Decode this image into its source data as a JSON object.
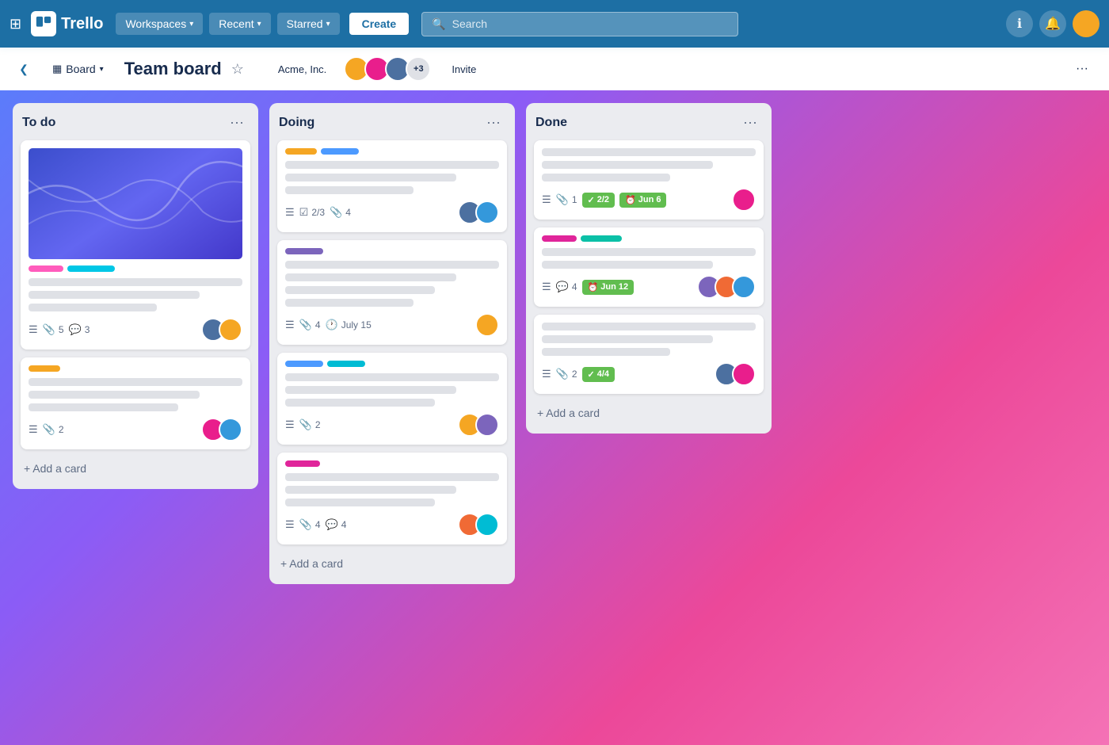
{
  "navbar": {
    "logo_text": "Trello",
    "workspaces_label": "Workspaces",
    "recent_label": "Recent",
    "starred_label": "Starred",
    "create_label": "Create",
    "search_placeholder": "Search",
    "info_label": "info",
    "notification_label": "notification",
    "user_label": "user avatar"
  },
  "board_header": {
    "view_label": "Board",
    "title": "Team board",
    "workspace_label": "Acme, Inc.",
    "members_extra": "+3",
    "invite_label": "Invite",
    "more_label": "···"
  },
  "columns": [
    {
      "id": "todo",
      "title": "To do",
      "menu_label": "···",
      "cards": [
        {
          "id": "card1",
          "has_cover": true,
          "labels": [
            "pink",
            "cyan"
          ],
          "lines": [
            "full",
            "medium",
            "short"
          ],
          "meta": [
            {
              "icon": "☰",
              "text": ""
            },
            {
              "icon": "📎",
              "text": "5"
            },
            {
              "icon": "💬",
              "text": "3"
            }
          ],
          "avatars": [
            "av-blue-dark",
            "av-yellow"
          ]
        },
        {
          "id": "card2",
          "has_cover": false,
          "labels": [
            "yellow"
          ],
          "lines": [
            "full",
            "medium",
            "w70"
          ],
          "meta": [
            {
              "icon": "☰",
              "text": ""
            },
            {
              "icon": "📎",
              "text": "2"
            }
          ],
          "avatars": [
            "av-pink",
            "av-blue"
          ]
        }
      ],
      "add_label": "+ Add a card"
    },
    {
      "id": "doing",
      "title": "Doing",
      "menu_label": "···",
      "cards": [
        {
          "id": "card3",
          "has_cover": false,
          "labels": [
            "yellow",
            "blue-label"
          ],
          "lines": [
            "full",
            "medium",
            "short"
          ],
          "meta": [
            {
              "icon": "☰",
              "text": ""
            },
            {
              "icon": "☑",
              "text": "2/3"
            },
            {
              "icon": "📎",
              "text": "4"
            }
          ],
          "avatars": [
            "av-blue-dark",
            "av-blue"
          ]
        },
        {
          "id": "card4",
          "has_cover": false,
          "labels": [
            "purple"
          ],
          "lines": [
            "full",
            "medium",
            "w70",
            "short"
          ],
          "meta": [
            {
              "icon": "☰",
              "text": ""
            },
            {
              "icon": "📎",
              "text": "4"
            },
            {
              "icon": "🕐",
              "text": "July 15"
            }
          ],
          "avatars": [
            "av-yellow"
          ]
        },
        {
          "id": "card5",
          "has_cover": false,
          "labels": [
            "blue",
            "cyan2"
          ],
          "lines": [
            "full",
            "medium",
            "w70"
          ],
          "meta": [
            {
              "icon": "☰",
              "text": ""
            },
            {
              "icon": "📎",
              "text": "2"
            }
          ],
          "avatars": [
            "av-yellow",
            "av-purple"
          ]
        },
        {
          "id": "card6",
          "has_cover": false,
          "labels": [
            "magenta"
          ],
          "lines": [
            "full",
            "medium",
            "w70"
          ],
          "meta": [
            {
              "icon": "☰",
              "text": ""
            },
            {
              "icon": "📎",
              "text": "4"
            },
            {
              "icon": "💬",
              "text": "4"
            }
          ],
          "avatars": [
            "av-user",
            "av-teal"
          ]
        }
      ],
      "add_label": "+ Add a card"
    },
    {
      "id": "done",
      "title": "Done",
      "menu_label": "···",
      "cards": [
        {
          "id": "card7",
          "has_cover": false,
          "labels": [],
          "lines": [
            "full",
            "medium",
            "short"
          ],
          "meta": [
            {
              "icon": "☰",
              "text": ""
            },
            {
              "icon": "📎",
              "text": "1"
            }
          ],
          "badges": [
            {
              "type": "check",
              "text": "2/2"
            },
            {
              "type": "clock",
              "text": "Jun 6"
            }
          ],
          "avatars": [
            "av-pink"
          ]
        },
        {
          "id": "card8",
          "has_cover": false,
          "labels": [
            "magenta",
            "teal"
          ],
          "lines": [
            "full",
            "medium"
          ],
          "meta": [
            {
              "icon": "☰",
              "text": ""
            },
            {
              "icon": "💬",
              "text": "4"
            }
          ],
          "badges": [
            {
              "type": "clock",
              "text": "Jun 12"
            }
          ],
          "avatars": [
            "av-purple",
            "av-orange",
            "av-blue"
          ]
        },
        {
          "id": "card9",
          "has_cover": false,
          "labels": [],
          "lines": [
            "full",
            "medium",
            "short"
          ],
          "meta": [
            {
              "icon": "☰",
              "text": ""
            },
            {
              "icon": "📎",
              "text": "2"
            }
          ],
          "badges": [
            {
              "type": "check",
              "text": "4/4"
            }
          ],
          "avatars": [
            "av-blue-dark",
            "av-pink"
          ]
        }
      ],
      "add_label": "+ Add a card"
    }
  ]
}
